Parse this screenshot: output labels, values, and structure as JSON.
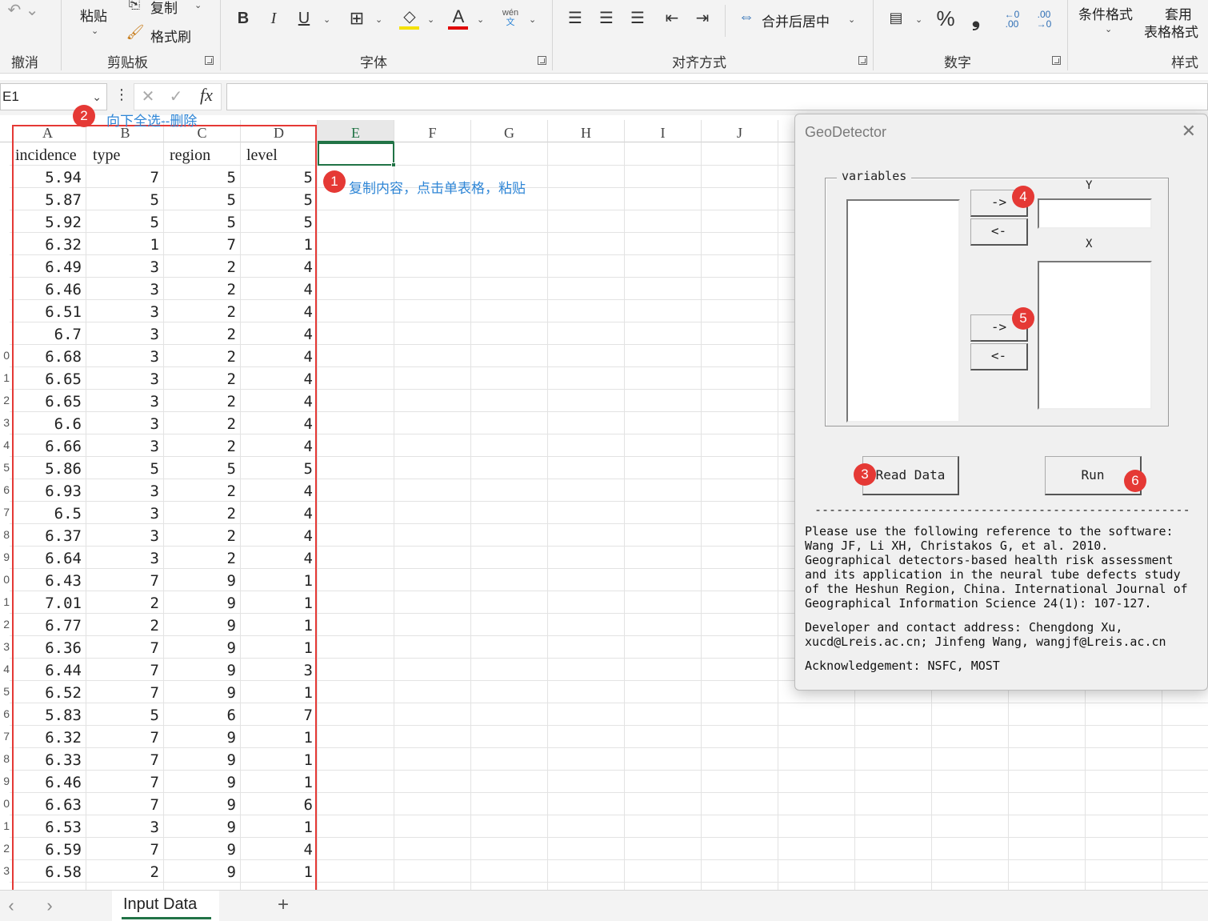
{
  "ribbon": {
    "undo_label": "撤消",
    "paste_label": "粘贴",
    "copy_label": "复制",
    "format_painter_label": "格式刷",
    "clipboard_label": "剪贴板",
    "bold": "B",
    "italic": "I",
    "underline": "U",
    "font_color_glyph": "A",
    "phonetic_top": "wén",
    "phonetic_bottom": "文",
    "font_label": "字体",
    "merge_center_label": "合并后居中",
    "alignment_label": "对齐方式",
    "percent_glyph": "%",
    "comma_glyph": "❟",
    "inc_decimal": "←0 .00",
    "dec_decimal": ".00 →0",
    "number_label": "数字",
    "cond_format_label": "条件格式",
    "table_format_label_1": "套用",
    "table_format_label_2": "表格格式",
    "styles_label": "样式",
    "highlight_color": "#f5e100",
    "font_color": "#e00000"
  },
  "formula_bar": {
    "name_box": "E1",
    "fx": "fx",
    "cancel": "✕",
    "enter": "✓",
    "content": ""
  },
  "sheet": {
    "columns": [
      "A",
      "B",
      "C",
      "D",
      "E",
      "F",
      "G",
      "H",
      "I",
      "J"
    ],
    "headers": [
      "incidence",
      "type",
      "region",
      "level"
    ],
    "rows": [
      [
        "5.94",
        "7",
        "5",
        "5"
      ],
      [
        "5.87",
        "5",
        "5",
        "5"
      ],
      [
        "5.92",
        "5",
        "5",
        "5"
      ],
      [
        "6.32",
        "1",
        "7",
        "1"
      ],
      [
        "6.49",
        "3",
        "2",
        "4"
      ],
      [
        "6.46",
        "3",
        "2",
        "4"
      ],
      [
        "6.51",
        "3",
        "2",
        "4"
      ],
      [
        "6.7",
        "3",
        "2",
        "4"
      ],
      [
        "6.68",
        "3",
        "2",
        "4"
      ],
      [
        "6.65",
        "3",
        "2",
        "4"
      ],
      [
        "6.65",
        "3",
        "2",
        "4"
      ],
      [
        "6.6",
        "3",
        "2",
        "4"
      ],
      [
        "6.66",
        "3",
        "2",
        "4"
      ],
      [
        "5.86",
        "5",
        "5",
        "5"
      ],
      [
        "6.93",
        "3",
        "2",
        "4"
      ],
      [
        "6.5",
        "3",
        "2",
        "4"
      ],
      [
        "6.37",
        "3",
        "2",
        "4"
      ],
      [
        "6.64",
        "3",
        "2",
        "4"
      ],
      [
        "6.43",
        "7",
        "9",
        "1"
      ],
      [
        "7.01",
        "2",
        "9",
        "1"
      ],
      [
        "6.77",
        "2",
        "9",
        "1"
      ],
      [
        "6.36",
        "7",
        "9",
        "1"
      ],
      [
        "6.44",
        "7",
        "9",
        "3"
      ],
      [
        "6.52",
        "7",
        "9",
        "1"
      ],
      [
        "5.83",
        "5",
        "6",
        "7"
      ],
      [
        "6.32",
        "7",
        "9",
        "1"
      ],
      [
        "6.33",
        "7",
        "9",
        "1"
      ],
      [
        "6.46",
        "7",
        "9",
        "1"
      ],
      [
        "6.63",
        "7",
        "9",
        "6"
      ],
      [
        "6.53",
        "3",
        "9",
        "1"
      ],
      [
        "6.59",
        "7",
        "9",
        "4"
      ],
      [
        "6.58",
        "2",
        "9",
        "1"
      ]
    ],
    "row_edge_digits": [
      "",
      "",
      "",
      "",
      "",
      "",
      "",
      "",
      "0",
      "1",
      "2",
      "3",
      "4",
      "5",
      "6",
      "7",
      "8",
      "9",
      "0",
      "1",
      "2",
      "3",
      "4",
      "5",
      "6",
      "7",
      "8",
      "9",
      "0",
      "1",
      "2",
      "3"
    ]
  },
  "annotations": {
    "step1_num": "1",
    "step1_text": "复制内容，点击单表格，粘贴",
    "step2_num": "2",
    "step2_text": "向下全选--删除",
    "step3_num": "3",
    "step4_num": "4",
    "step5_num": "5",
    "step6_num": "6",
    "accent_color": "#e53935"
  },
  "tabs": {
    "sheet_name": "Input Data",
    "add": "+",
    "prev": "‹",
    "next": "›"
  },
  "dialog": {
    "title": "GeoDetector",
    "close": "✕",
    "variables_label": "variables",
    "y_label": "Y",
    "x_label": "X",
    "add_y": "->",
    "remove_y": "<-",
    "add_x": "->",
    "remove_x": "<-",
    "read_data": "Read Data",
    "run": "Run",
    "separator": "--------------------------------------------------------",
    "reference": "Please use the following reference to the software:\nWang JF, Li XH, Christakos G, et al. 2010.\nGeographical detectors-based health risk assessment\nand its application in the neural tube defects study\nof the Heshun Region, China. International Journal of\nGeographical Information Science 24(1): 107-127.",
    "contact": "Developer and contact address: Chengdong Xu,\nxucd@Lreis.ac.cn; Jinfeng Wang, wangjf@Lreis.ac.cn",
    "acknowledgement": "Acknowledgement: NSFC, MOST"
  }
}
